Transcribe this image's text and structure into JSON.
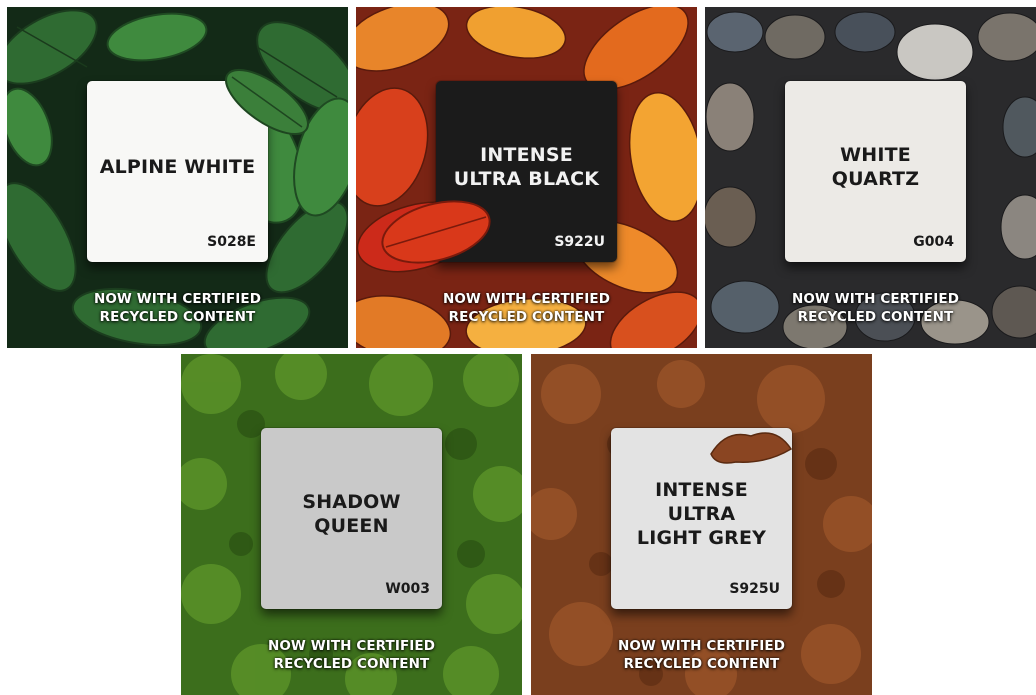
{
  "tiles": [
    {
      "name": "ALPINE WHITE",
      "code": "S028E",
      "caption_line1": "NOW WITH CERTIFIED",
      "caption_line2": "RECYCLED CONTENT",
      "background": "green leaves",
      "swatch_color": "#f8f8f6"
    },
    {
      "name": "INTENSE\nULTRA BLACK",
      "code": "S922U",
      "caption_line1": "NOW WITH CERTIFIED",
      "caption_line2": "RECYCLED CONTENT",
      "background": "autumn leaves",
      "swatch_color": "#1b1b1b"
    },
    {
      "name": "WHITE QUARTZ",
      "code": "G004",
      "caption_line1": "NOW WITH CERTIFIED",
      "caption_line2": "RECYCLED CONTENT",
      "background": "river pebbles",
      "swatch_color": "#eceae6"
    },
    {
      "name": "SHADOW\nQUEEN",
      "code": "W003",
      "caption_line1": "NOW WITH CERTIFIED",
      "caption_line2": "RECYCLED CONTENT",
      "background": "moss",
      "swatch_color": "#c9c9c9"
    },
    {
      "name": "INTENSE ULTRA\nLIGHT GREY",
      "code": "S925U",
      "caption_line1": "NOW WITH CERTIFIED",
      "caption_line2": "RECYCLED CONTENT",
      "background": "soil",
      "swatch_color": "#e3e3e3"
    }
  ]
}
